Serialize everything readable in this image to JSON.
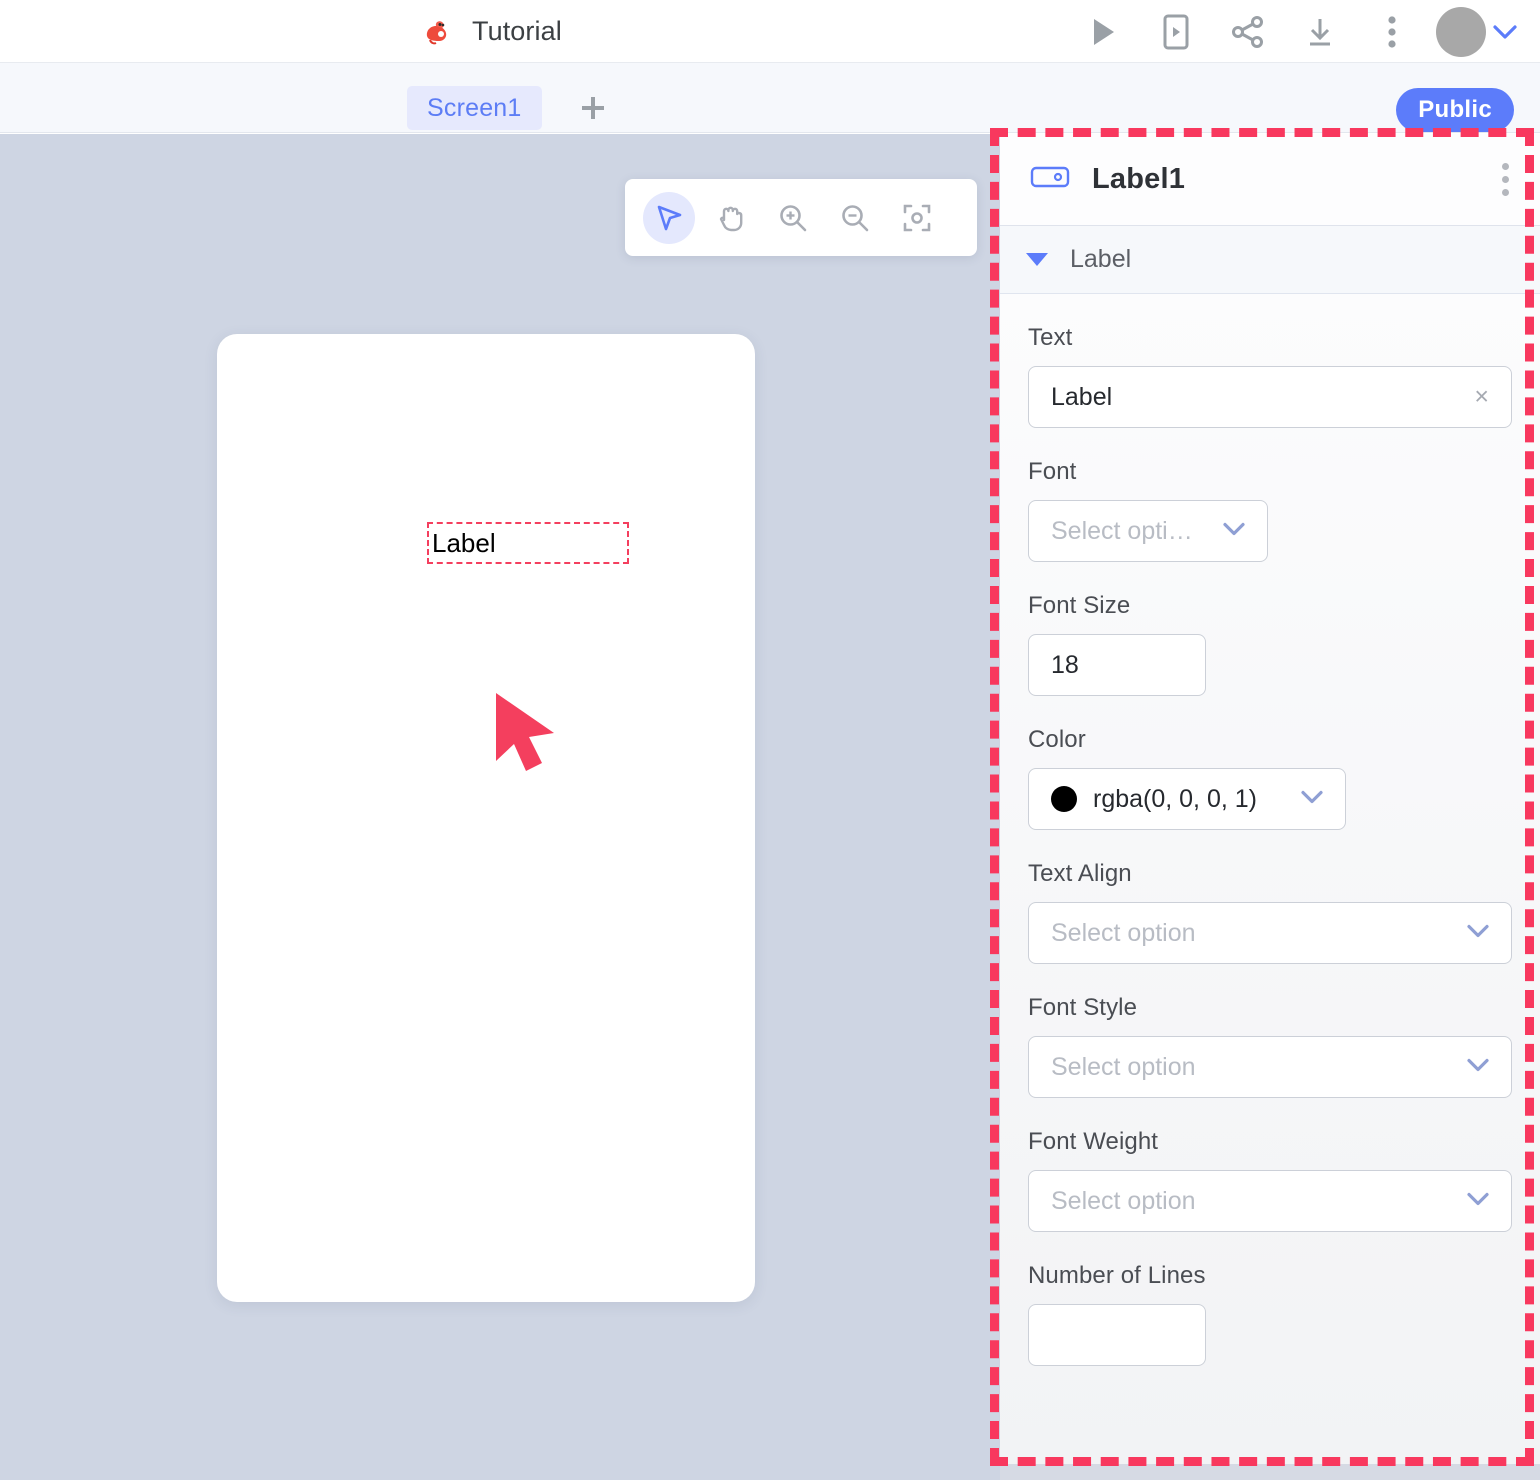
{
  "topbar": {
    "logo_icon": "bird-logo-icon",
    "title": "Tutorial",
    "actions": [
      {
        "name": "run-preview-button",
        "icon": "play-icon"
      },
      {
        "name": "mobile-preview-button",
        "icon": "mobile-phone-icon"
      },
      {
        "name": "share-button",
        "icon": "share-icon"
      },
      {
        "name": "download-button",
        "icon": "download-icon"
      },
      {
        "name": "more-options-button",
        "icon": "vertical-dots-icon"
      }
    ],
    "avatar": "user-avatar",
    "avatar_caret": "chevron-down-icon"
  },
  "tabbar": {
    "screen_tab": "Screen1",
    "add_screen_label": "+",
    "visibility_button": "Public"
  },
  "canvas": {
    "toolbar": [
      {
        "name": "select-tool",
        "icon": "cursor-arrow-icon",
        "active": true
      },
      {
        "name": "pan-tool",
        "icon": "hand-icon",
        "active": false
      },
      {
        "name": "zoom-in-tool",
        "icon": "magnifier-plus-icon",
        "active": false
      },
      {
        "name": "zoom-out-tool",
        "icon": "magnifier-minus-icon",
        "active": false
      },
      {
        "name": "fit-to-screen-tool",
        "icon": "focus-frame-icon",
        "active": false
      }
    ],
    "selected_element_text": "Label"
  },
  "panel": {
    "icon": "label-component-icon",
    "title": "Label1",
    "menu_icon": "vertical-dots-icon",
    "section": {
      "caret_icon": "caret-down-icon",
      "title": "Label"
    },
    "fields": {
      "text": {
        "label": "Text",
        "value": "Label",
        "clear_icon": "×"
      },
      "font": {
        "label": "Font",
        "placeholder": "Select opti…",
        "caret_icon": "chevron-down-icon"
      },
      "font_size": {
        "label": "Font Size",
        "value": "18"
      },
      "color": {
        "label": "Color",
        "value": "rgba(0, 0, 0, 1)",
        "swatch_hex": "#000000",
        "caret_icon": "chevron-down-icon"
      },
      "text_align": {
        "label": "Text Align",
        "placeholder": "Select option",
        "caret_icon": "chevron-down-icon"
      },
      "font_style": {
        "label": "Font Style",
        "placeholder": "Select option",
        "caret_icon": "chevron-down-icon"
      },
      "font_weight": {
        "label": "Font Weight",
        "placeholder": "Select option",
        "caret_icon": "chevron-down-icon"
      },
      "number_of_lines": {
        "label": "Number of Lines",
        "value": ""
      }
    }
  },
  "annotation": {
    "highlight_color": "#f8385e",
    "cursor_color": "#f43f5e"
  }
}
